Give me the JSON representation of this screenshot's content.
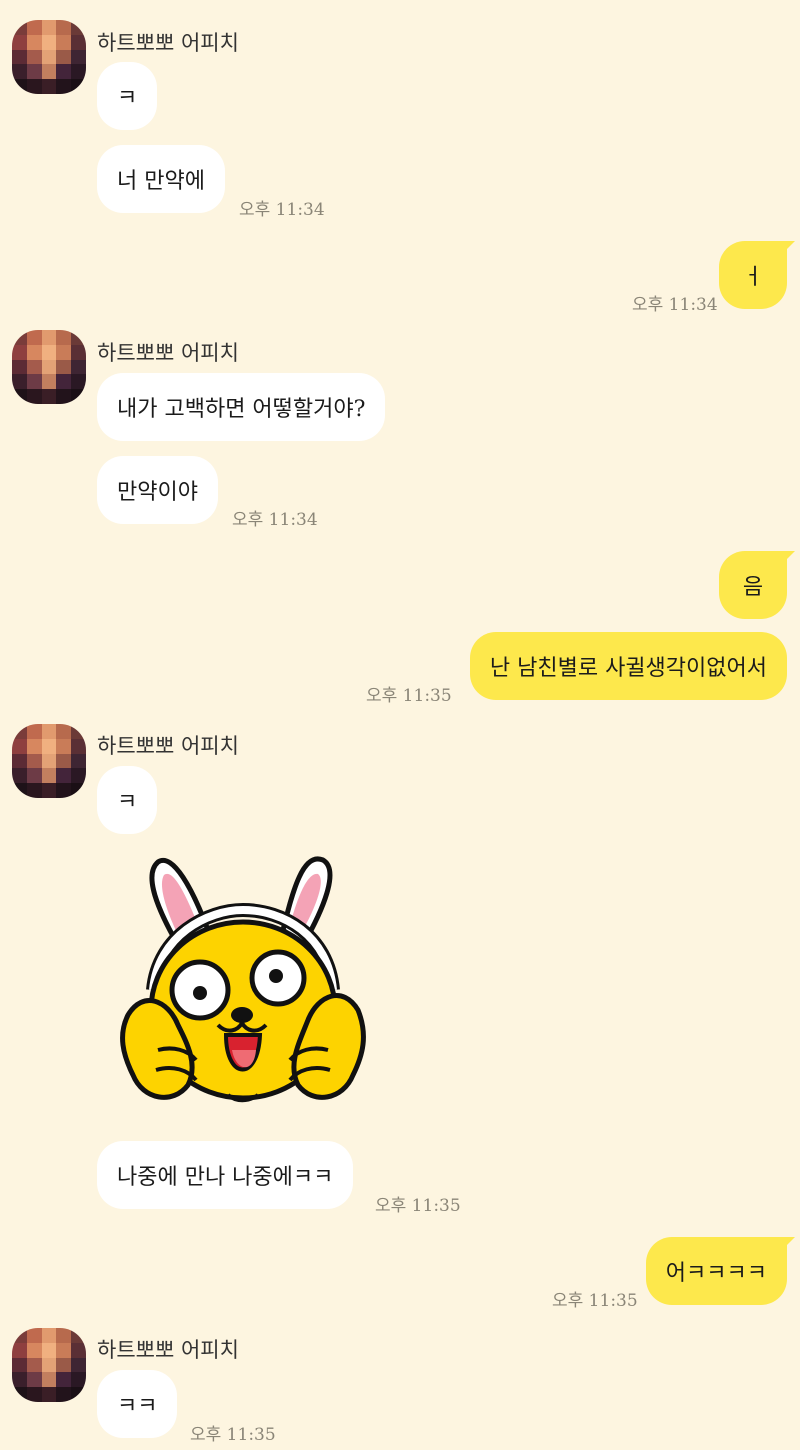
{
  "contact_name": "하트뽀뽀 어피치",
  "messages": {
    "m1": "ㅋ",
    "m2": "너 만약에",
    "m3": "ㅓ",
    "m4": "내가 고백하면 어떻할거야?",
    "m5": "만약이야",
    "m6": "음",
    "m7": "난 남친별로 사귈생각이없어서",
    "m8": "ㅋ",
    "m9": "나중에 만나 나중에ㅋㅋ",
    "m10": "어ㅋㅋㅋㅋ",
    "m11": "ㅋㅋ"
  },
  "times": {
    "t1": "오후 11:34",
    "t2": "오후 11:34",
    "t3": "오후 11:34",
    "t4": "오후 11:35",
    "t5": "오후 11:35",
    "t6": "오후 11:35",
    "t7": "오후 11:35"
  },
  "sticker": {
    "icon": "bunny-dog-character-sticker-icon"
  },
  "colors": {
    "background": "#fdf5e0",
    "incoming_bubble": "#ffffff",
    "outgoing_bubble": "#fde84c",
    "timestamp": "#8a8577"
  }
}
